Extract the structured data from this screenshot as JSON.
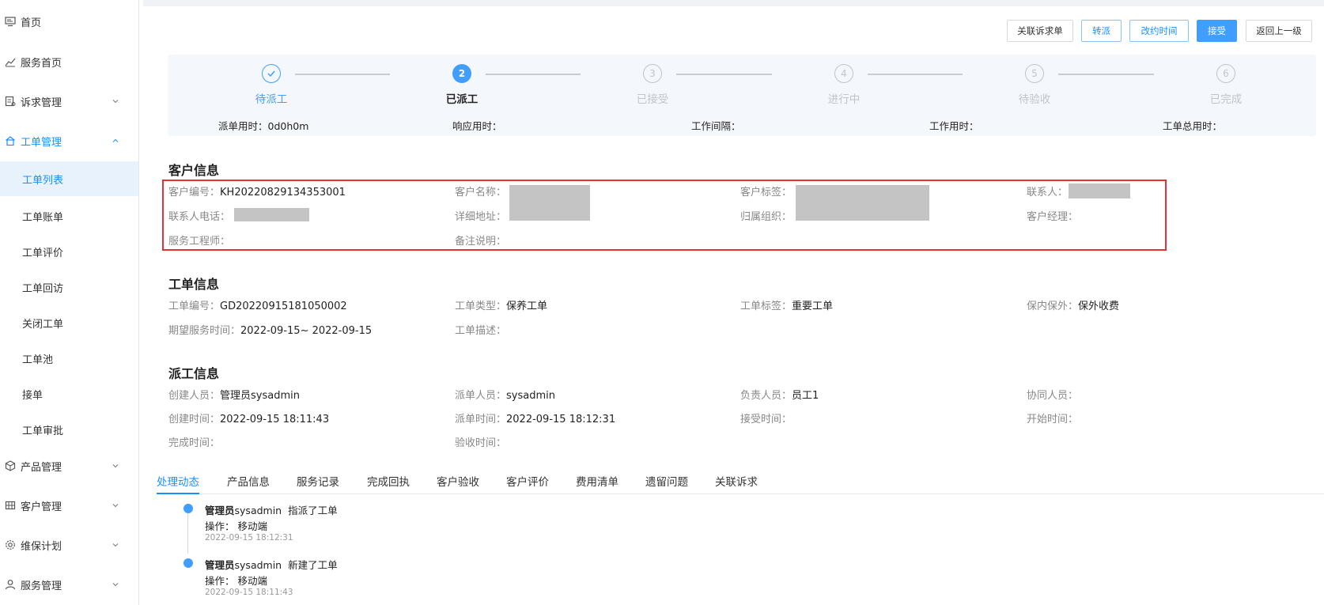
{
  "sidebar": {
    "items": [
      {
        "label": "首页",
        "icon": "monitor-icon"
      },
      {
        "label": "服务首页",
        "icon": "chart-line-icon"
      },
      {
        "label": "诉求管理",
        "icon": "request-icon"
      },
      {
        "label": "工单管理",
        "icon": "home-icon"
      },
      {
        "label": "工单列表"
      },
      {
        "label": "工单账单"
      },
      {
        "label": "工单评价"
      },
      {
        "label": "工单回访"
      },
      {
        "label": "关闭工单"
      },
      {
        "label": "工单池"
      },
      {
        "label": "接单"
      },
      {
        "label": "工单审批"
      },
      {
        "label": "产品管理",
        "icon": "cube-icon"
      },
      {
        "label": "客户管理",
        "icon": "grid-icon"
      },
      {
        "label": "维保计划",
        "icon": "gear-icon"
      },
      {
        "label": "服务管理",
        "icon": "user-icon"
      }
    ]
  },
  "toolbar": {
    "link_request": "关联诉求单",
    "transfer": "转派",
    "change_time": "改约时间",
    "accept": "接受",
    "back": "返回上一级"
  },
  "steps": {
    "items": [
      {
        "num": "1",
        "label": "待派工",
        "status": "done"
      },
      {
        "num": "2",
        "label": "已派工",
        "status": "current"
      },
      {
        "num": "3",
        "label": "已接受",
        "status": "wait"
      },
      {
        "num": "4",
        "label": "进行中",
        "status": "wait"
      },
      {
        "num": "5",
        "label": "待验收",
        "status": "wait"
      },
      {
        "num": "6",
        "label": "已完成",
        "status": "wait"
      }
    ],
    "times": {
      "dispatch": "派单用时：0d0h0m",
      "response": "响应用时：",
      "interval": "工作间隔：",
      "work": "工作用时：",
      "total": "工单总用时："
    }
  },
  "customer": {
    "title": "客户信息",
    "code_k": "客户编号：",
    "code_v": "KH20220829134353001",
    "name_k": "客户名称：",
    "tag_k": "客户标签：",
    "contact_k": "联系人：",
    "phone_k": "联系人电话：",
    "address_k": "详细地址：",
    "org_k": "归属组织：",
    "manager_k": "客户经理：",
    "engineer_k": "服务工程师：",
    "remark_k": "备注说明："
  },
  "order": {
    "title": "工单信息",
    "code_k": "工单编号：",
    "code_v": "GD20220915181050002",
    "type_k": "工单类型：",
    "type_v": "保养工单",
    "tag_k": "工单标签：",
    "tag_v": "重要工单",
    "warranty_k": "保内保外：",
    "warranty_v": "保外收费",
    "expect_k": "期望服务时间：",
    "expect_v": "2022-09-15~ 2022-09-15",
    "desc_k": "工单描述："
  },
  "dispatch": {
    "title": "派工信息",
    "creator_k": "创建人员：",
    "creator_v": "管理员sysadmin",
    "dispatcher_k": "派单人员：",
    "dispatcher_v": "sysadmin",
    "owner_k": "负责人员：",
    "owner_v": "员工1",
    "assist_k": "协同人员：",
    "create_time_k": "创建时间：",
    "create_time_v": "2022-09-15 18:11:43",
    "dispatch_time_k": "派单时间：",
    "dispatch_time_v": "2022-09-15 18:12:31",
    "accept_time_k": "接受时间：",
    "start_time_k": "开始时间：",
    "finish_time_k": "完成时间：",
    "check_time_k": "验收时间："
  },
  "tabs": [
    "处理动态",
    "产品信息",
    "服务记录",
    "完成回执",
    "客户验收",
    "客户评价",
    "费用清单",
    "遗留问题",
    "关联诉求"
  ],
  "timeline": [
    {
      "who": "管理员",
      "user": "sysadmin",
      "action": "指派了工单",
      "op": "操作：  移动端",
      "time": "2022-09-15 18:12:31"
    },
    {
      "who": "管理员",
      "user": "sysadmin",
      "action": "新建了工单",
      "op": "操作：  移动端",
      "time": "2022-09-15 18:11:43"
    }
  ],
  "colors": {
    "accent": "#409eff",
    "highlight_box": "#e53333"
  }
}
